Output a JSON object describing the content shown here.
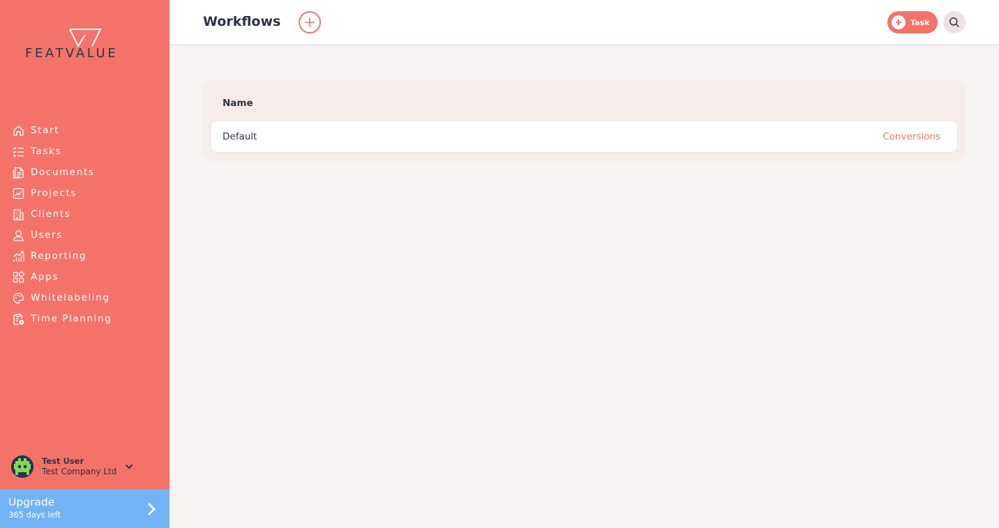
{
  "brand": {
    "name": "FEATVALUE",
    "accent": "#f3736b",
    "upgrade_color": "#71b3f5"
  },
  "sidebar": {
    "items": [
      {
        "label": "Start",
        "icon": "home-icon"
      },
      {
        "label": "Tasks",
        "icon": "tasks-icon"
      },
      {
        "label": "Documents",
        "icon": "documents-icon"
      },
      {
        "label": "Projects",
        "icon": "projects-icon"
      },
      {
        "label": "Clients",
        "icon": "clients-icon"
      },
      {
        "label": "Users",
        "icon": "user-icon"
      },
      {
        "label": "Reporting",
        "icon": "reporting-icon"
      },
      {
        "label": "Apps",
        "icon": "apps-icon"
      },
      {
        "label": "Whitelabeling",
        "icon": "palette-icon"
      },
      {
        "label": "Time Planning",
        "icon": "time-planning-icon"
      }
    ],
    "user": {
      "name": "Test User",
      "company": "Test Company Ltd"
    },
    "upgrade": {
      "title": "Upgrade",
      "subtitle": "365 days left"
    }
  },
  "header": {
    "title": "Workflows",
    "task_button_label": "Task"
  },
  "table": {
    "column_header": "Name",
    "rows": [
      {
        "name": "Default",
        "link": "Conversions"
      }
    ]
  }
}
